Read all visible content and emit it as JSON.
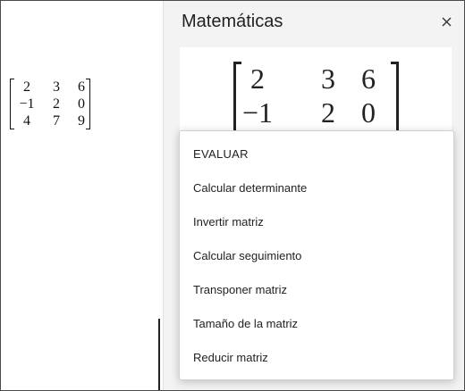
{
  "pane": {
    "title": "Matemáticas",
    "close_icon": "close-icon"
  },
  "matrix": {
    "rows": [
      [
        "2",
        "3",
        "6"
      ],
      [
        "−1",
        "2",
        "0"
      ],
      [
        "4",
        "7",
        "9"
      ]
    ]
  },
  "menu": {
    "header": "EVALUAR",
    "items": [
      "Calcular determinante",
      "Invertir matriz",
      "Calcular seguimiento",
      "Transponer matriz",
      "Tamaño de la matriz",
      "Reducir matriz"
    ]
  },
  "colors": {
    "accent": "#8a5ab8"
  }
}
